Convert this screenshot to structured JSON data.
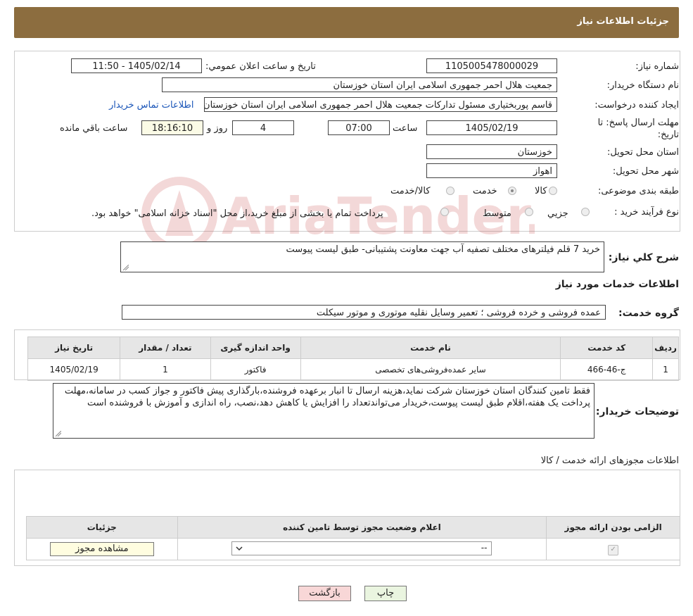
{
  "header": {
    "title": "جزئیات اطلاعات نیاز"
  },
  "form": {
    "need_number_label": "شماره نیاز:",
    "need_number": "1105005478000029",
    "announce_label": "تاریخ و ساعت اعلان عمومي:",
    "announce_value": "1405/02/14 - 11:50",
    "buyer_org_label": "نام دستگاه خريدار:",
    "buyer_org": "جمعیت هلال احمر جمهوری اسلامی ایران استان خوزستان",
    "creator_label": "ايجاد كننده درخواست:",
    "creator": "قاسم پوربختیاری مسئول تدارکات جمعیت هلال احمر جمهوری اسلامی ایران استان خوزستان",
    "contact_link": "اطلاعات تماس خريدار",
    "deadline_label_1": "مهلت ارسال پاسخ: تا",
    "deadline_label_2": "تاريخ:",
    "deadline_date": "1405/02/19",
    "time_label": "ساعت",
    "deadline_time": "07:00",
    "days_value": "4",
    "days_label": "روز و",
    "remaining_time": "18:16:10",
    "remaining_label": "ساعت باقي مانده",
    "province_label": "استان محل تحويل:",
    "province": "خوزستان",
    "city_label": "شهر محل تحويل:",
    "city": "اهواز",
    "category_label": "طبقه بندی موضوعی:",
    "category_options": [
      "كالا",
      "خدمت",
      "كالا/خدمت"
    ],
    "category_selected": "خدمت",
    "process_label": "نوع فرآيند خريد :",
    "process_options": [
      "جزيي",
      "متوسط"
    ],
    "process_note": "پرداخت تمام يا بخشی از مبلغ خريد،از محل \"اسناد خزانه اسلامی\" خواهد بود."
  },
  "summary": {
    "label": "شرح كلي نياز:",
    "text": "خرید 7 قلم فیلترهای مختلف تصفیه آب جهت معاونت پشتیبانی- طبق لیست پیوست"
  },
  "services": {
    "section_title": "اطلاعات خدمات مورد نياز",
    "group_label": "گروه خدمت:",
    "group_value": "عمده فروشی و خرده فروشی ؛ تعمیر وسایل نقلیه موتوری و موتور سیکلت",
    "columns": [
      "رديف",
      "كد خدمت",
      "نام خدمت",
      "واحد اندازه گيری",
      "تعداد / مقدار",
      "تاريخ نياز"
    ],
    "rows": [
      [
        "1",
        "ج-46-466",
        "سایر عمده‌فروشی‌های تخصصی",
        "فاکتور",
        "1",
        "1405/02/19"
      ]
    ]
  },
  "buyer_notes": {
    "label": "توضيحات خريدار:",
    "text": "فقط تامین کنندگان استان خوزستان شرکت نماید،هزینه ارسال تا انبار برعهده فروشنده،بارگذاری پیش فاکتور و جواز کسب در سامانه،مهلت پرداخت یک هفته،اقلام طبق لیست پیوست،خریدار می‌تواندتعداد را افزایش یا کاهش دهد،نصب، راه اندازی و آموزش با فروشنده است"
  },
  "permits": {
    "section_title": "اطلاعات مجوزهای ارائه خدمت / كالا",
    "columns": [
      "الزامی بودن ارائه مجوز",
      "اعلام وضعيت مجوز توسط تامين كننده",
      "جزئيات"
    ],
    "status_value": "--",
    "view_button": "مشاهده مجوز"
  },
  "buttons": {
    "print": "چاپ",
    "back": "بازگشت"
  },
  "watermark": {
    "text": "AriaTender.neT"
  },
  "colors": {
    "header": "#8c6d3f",
    "link": "#1a55b8",
    "back_button": "#f8d7d7",
    "print_button": "#eaf5e0",
    "view_button": "#fffde0"
  }
}
